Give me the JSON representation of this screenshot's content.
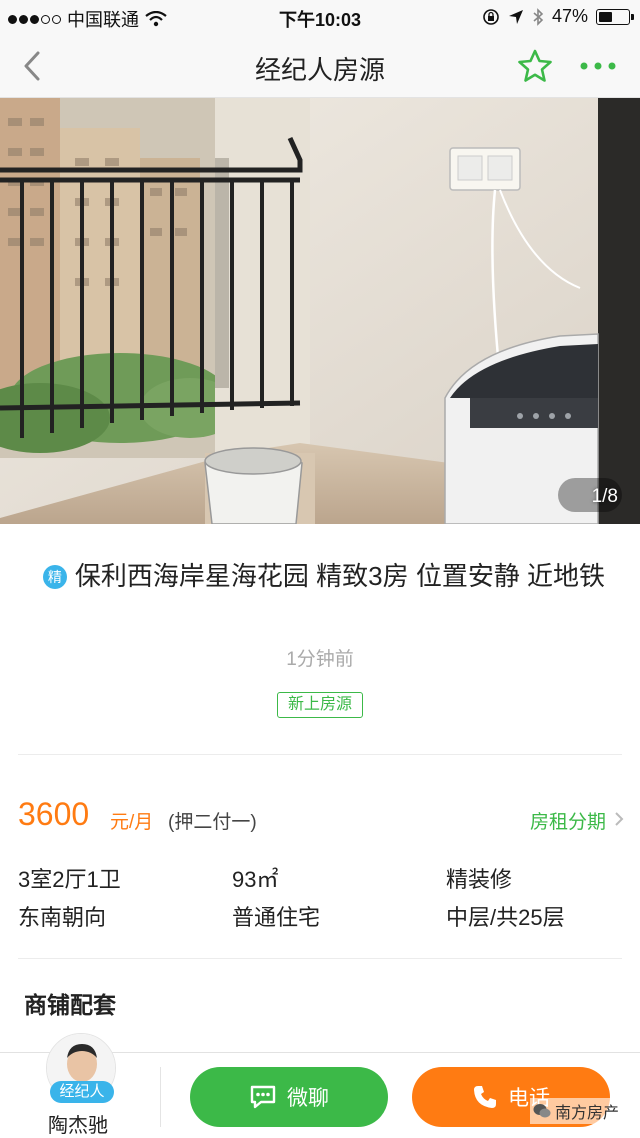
{
  "status_bar": {
    "carrier": "中国联通",
    "time": "下午10:03",
    "battery": "47%",
    "battery_level": 0.47
  },
  "nav": {
    "title": "经纪人房源"
  },
  "photo": {
    "counter": "1/8"
  },
  "listing": {
    "featured_badge": "精",
    "title": "保利西海岸星海花园 精致3房 位置安静 近地铁",
    "posted": "1分钟前",
    "tag": "新上房源"
  },
  "price": {
    "amount": "3600",
    "unit": "元/月",
    "deposit": "(押二付一)",
    "installment": "房租分期"
  },
  "specs": {
    "layout": "3室2厅1卫",
    "area": "93㎡",
    "decoration": "精装修",
    "orientation": "东南朝向",
    "type": "普通住宅",
    "floor": "中层/共25层"
  },
  "section": {
    "title": "商铺配套"
  },
  "agent": {
    "badge": "经纪人",
    "name": "陶杰驰"
  },
  "actions": {
    "chat": "微聊",
    "call": "电话"
  },
  "watermark": {
    "text": "南方房产"
  },
  "colors": {
    "accent_green": "#3cb948",
    "price_orange": "#ff7b12",
    "badge_blue": "#3ab4ea"
  }
}
